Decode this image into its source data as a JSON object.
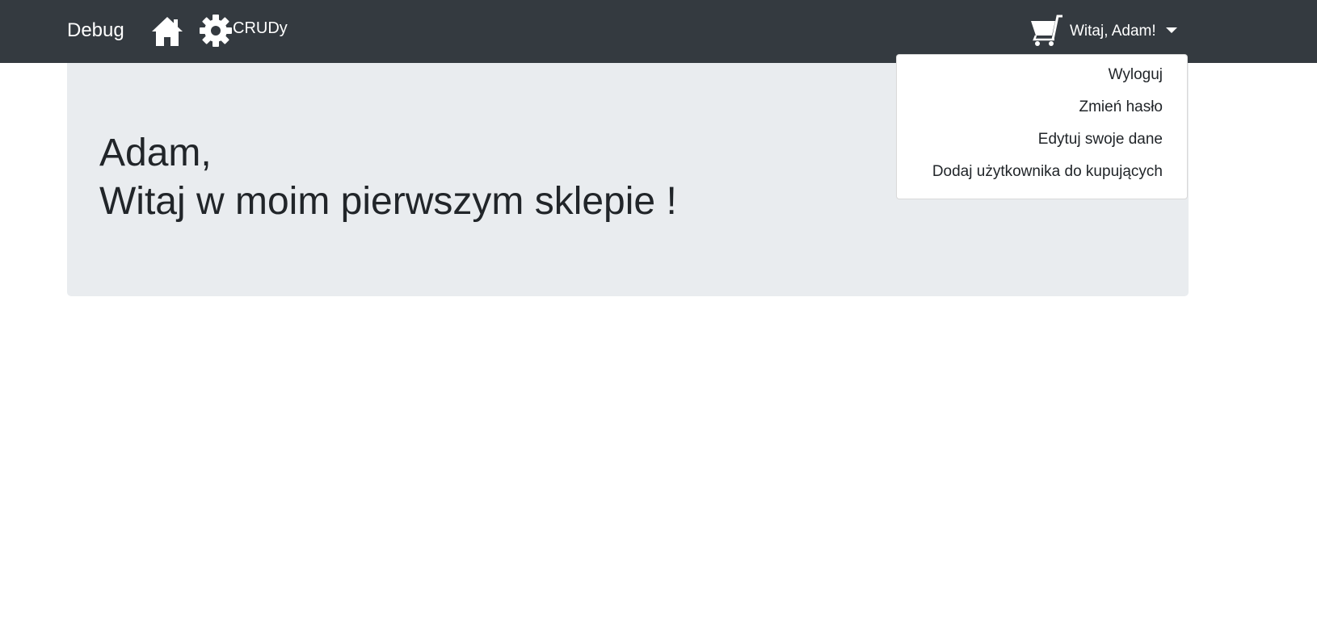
{
  "navbar": {
    "brand": "Debug",
    "home_icon": "home-icon",
    "crud_icon": "gear-icon",
    "crud_label": "CRUDy",
    "cart_icon": "cart-icon",
    "user_menu_label": "Witaj, Adam!",
    "background_color": "#343a40"
  },
  "user_dropdown": {
    "items": [
      {
        "label": "Wyloguj"
      },
      {
        "label": "Zmień hasło"
      },
      {
        "label": "Edytuj swoje dane"
      },
      {
        "label": "Dodaj użytkownika do kupujących"
      }
    ]
  },
  "jumbotron": {
    "line1": "Adam,",
    "line2": "Witaj w moim pierwszym sklepie !",
    "background_color": "#e9ecef"
  }
}
